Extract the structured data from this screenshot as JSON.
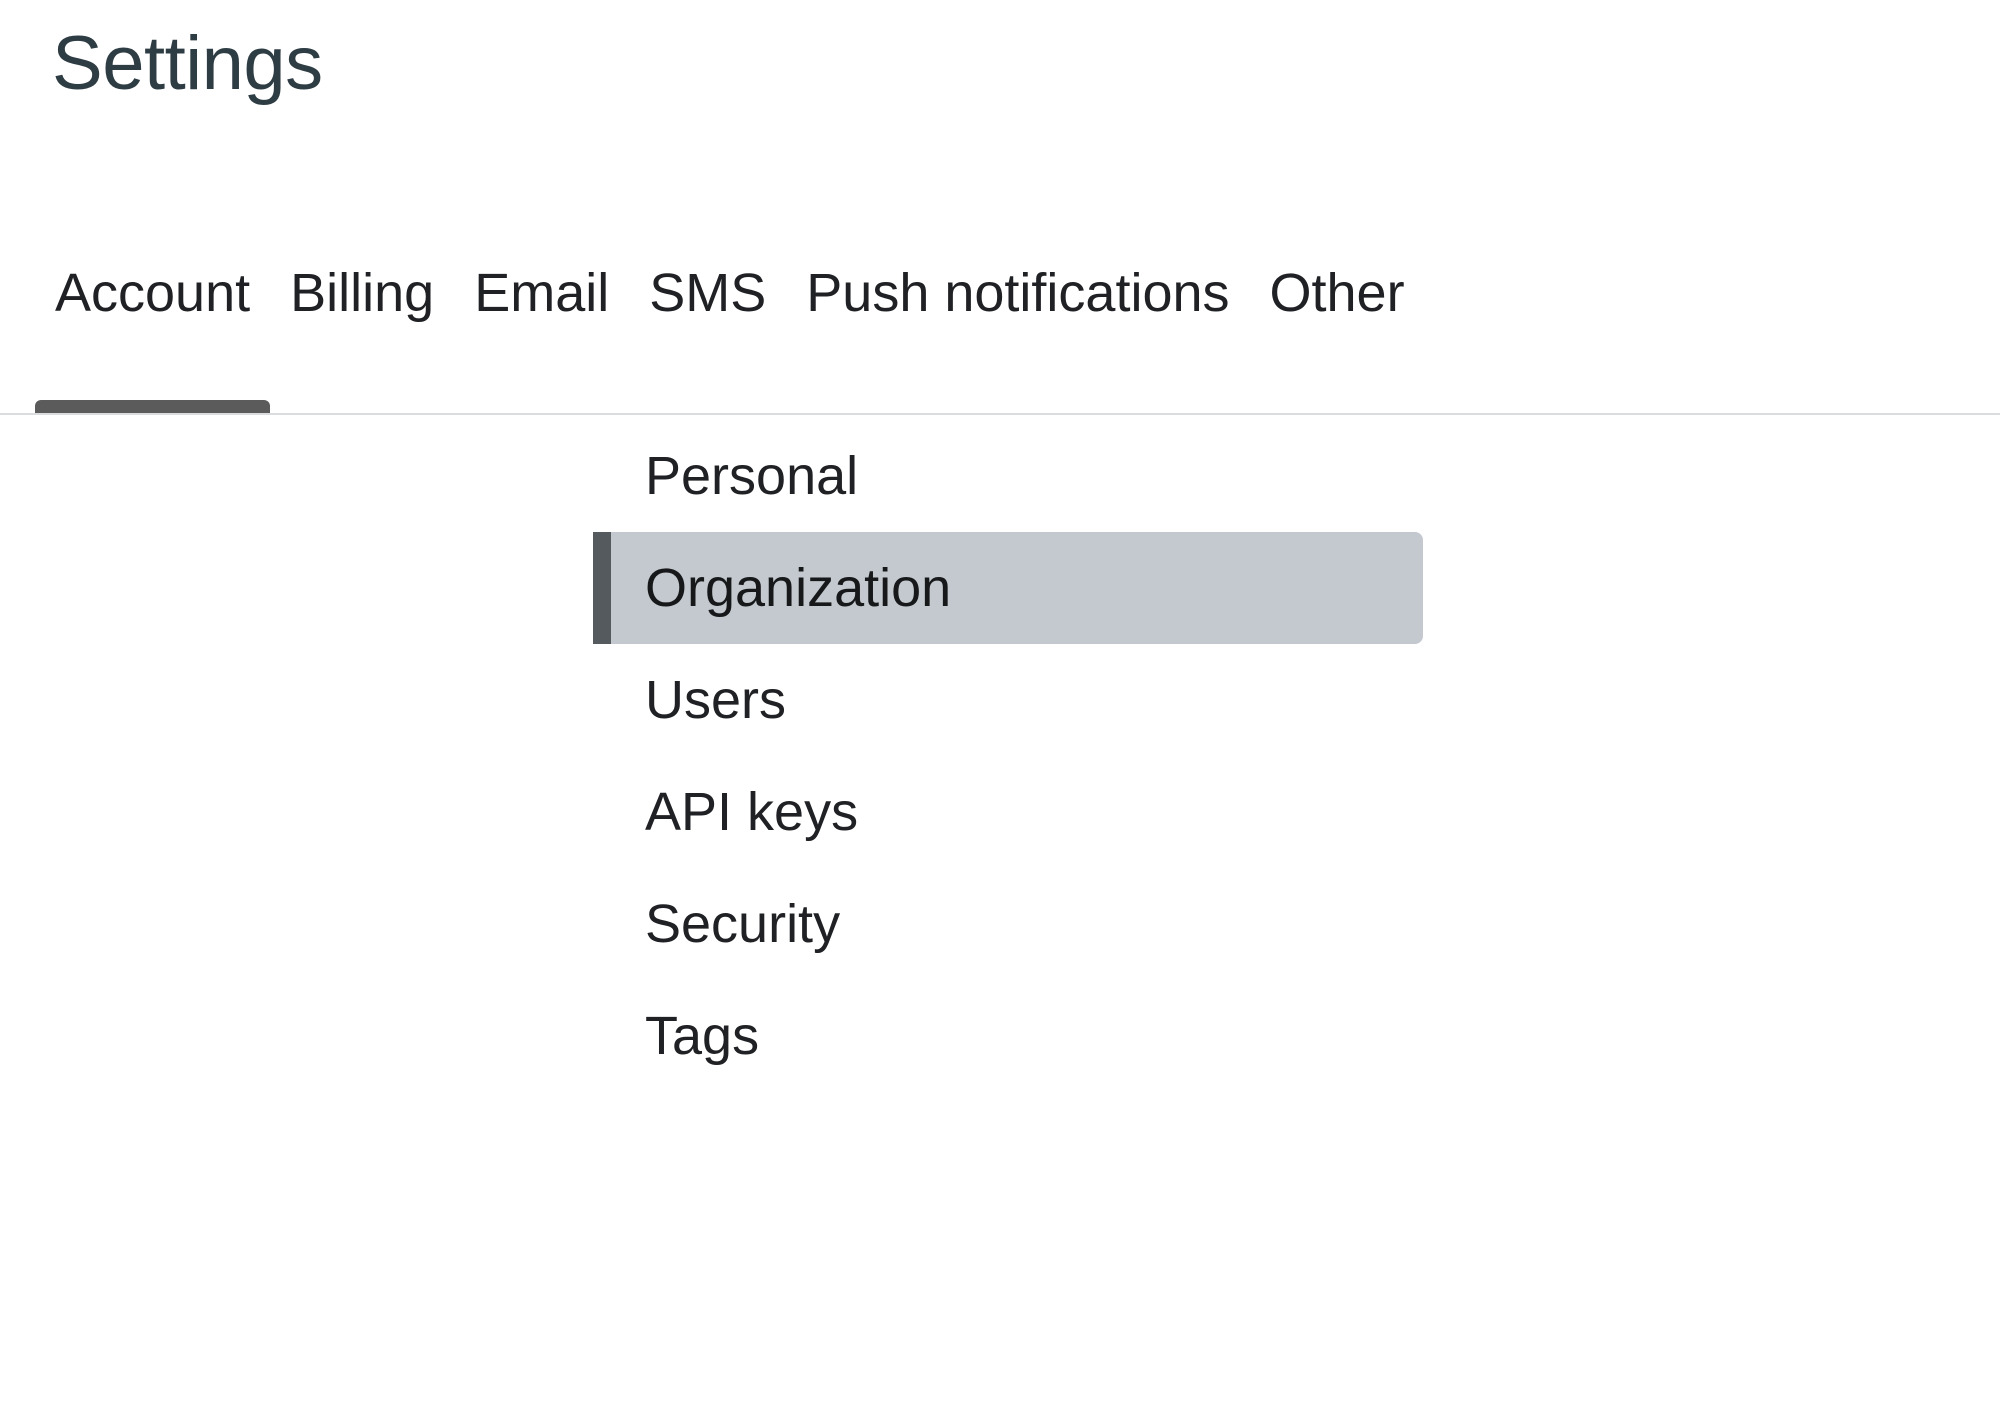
{
  "page": {
    "title": "Settings"
  },
  "tabs": {
    "items": [
      {
        "label": "Account",
        "active": true
      },
      {
        "label": "Billing",
        "active": false
      },
      {
        "label": "Email",
        "active": false
      },
      {
        "label": "SMS",
        "active": false
      },
      {
        "label": "Push notifications",
        "active": false
      },
      {
        "label": "Other",
        "active": false
      }
    ]
  },
  "submenu": {
    "items": [
      {
        "label": "Personal",
        "selected": false
      },
      {
        "label": "Organization",
        "selected": true
      },
      {
        "label": "Users",
        "selected": false
      },
      {
        "label": "API keys",
        "selected": false
      },
      {
        "label": "Security",
        "selected": false
      },
      {
        "label": "Tags",
        "selected": false
      }
    ]
  },
  "colors": {
    "title_text": "#2e3c43",
    "text": "#202124",
    "tab_indicator": "#5b5b5b",
    "divider": "#dadce0",
    "selected_row_bg": "#c3c9ce",
    "selected_row_bar": "#555a5e",
    "background": "#ffffff"
  }
}
